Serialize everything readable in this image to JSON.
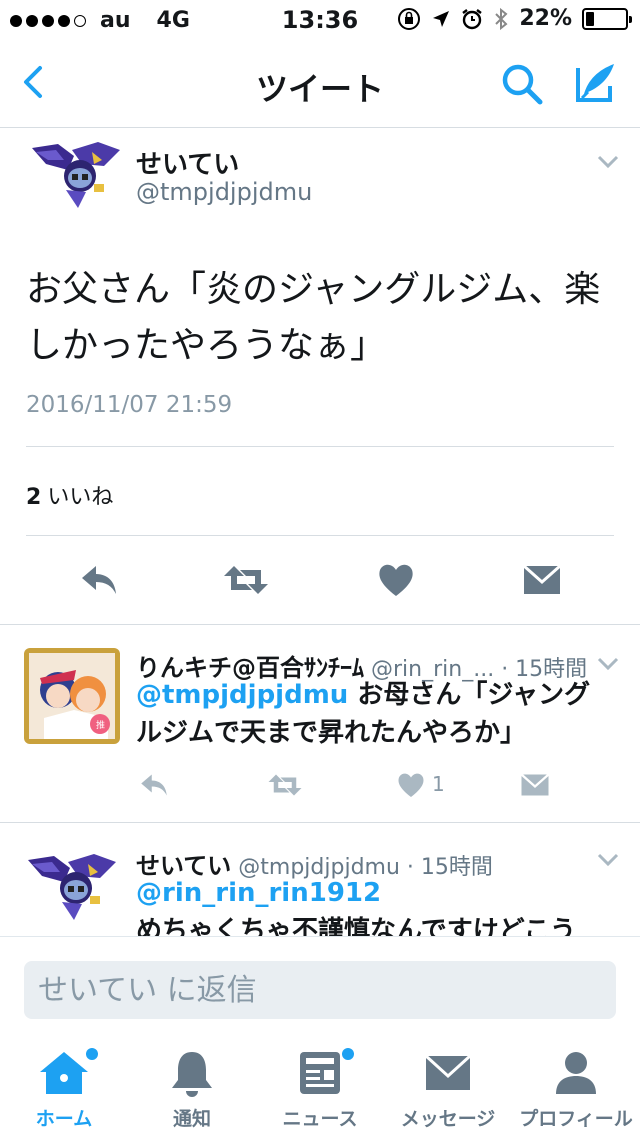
{
  "status_bar": {
    "carrier": "au",
    "network": "4G",
    "time": "13:36",
    "battery_percent": "22%",
    "battery_level": 0.22,
    "signal_bars_filled": 4,
    "signal_bars_total": 5
  },
  "nav": {
    "title": "ツイート",
    "icons": [
      "back-icon",
      "search-icon",
      "compose-icon"
    ],
    "accent_color": "#1da1f2"
  },
  "main_tweet": {
    "name": "せいてい",
    "handle": "@tmpjdjpjdmu",
    "text": "お父さん「炎のジャングルジム、楽しかったやろうなぁ」",
    "timestamp": "2016/11/07 21:59",
    "likes_count": "2",
    "likes_label": "いいね",
    "actions": [
      "reply-icon",
      "retweet-icon",
      "like-icon",
      "message-icon"
    ]
  },
  "replies": [
    {
      "name": "りんキチ@百合ｻﾝﾁｰﾑ",
      "handle": "@rin_rin_...",
      "time": "· 15時間",
      "mention": "@tmpjdjpjdmu",
      "text": " お母さん「ジャングルジムで天まで昇れたんやろか」",
      "like_count": "1"
    },
    {
      "name": "せいてい",
      "handle": "@tmpjdjpjdmu",
      "time": "· 15時間",
      "mention": "@rin_rin_rin1912",
      "text": "めちゃくちゃ不謹慎なんですけどこう"
    }
  ],
  "reply_box": {
    "placeholder": "せいてい に返信"
  },
  "tab_bar": {
    "tabs": [
      {
        "label": "ホーム",
        "icon": "home-icon",
        "active": true,
        "badge": true
      },
      {
        "label": "通知",
        "icon": "bell-icon",
        "active": false,
        "badge": false
      },
      {
        "label": "ニュース",
        "icon": "news-icon",
        "active": false,
        "badge": true
      },
      {
        "label": "メッセージ",
        "icon": "envelope-icon",
        "active": false,
        "badge": false
      },
      {
        "label": "プロフィール",
        "icon": "profile-icon",
        "active": false,
        "badge": false
      }
    ]
  }
}
